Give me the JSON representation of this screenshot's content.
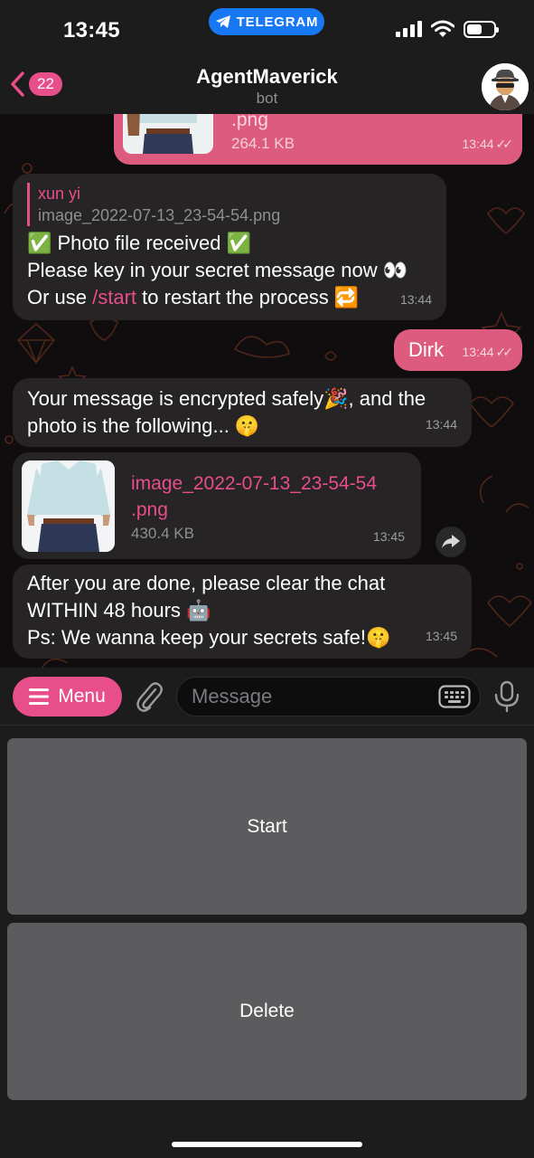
{
  "status_bar": {
    "time": "13:45",
    "app_pill": "TELEGRAM"
  },
  "header": {
    "back_count": "22",
    "title": "AgentMaverick",
    "subtitle": "bot"
  },
  "messages": {
    "m0": {
      "file_ext": ".png",
      "size": "264.1 KB",
      "time": "13:44"
    },
    "m1": {
      "reply_name": "xun yi",
      "reply_text": "image_2022-07-13_23-54-54.png",
      "line1": "✅ Photo file received ✅",
      "line2": "Please key in your secret message now 👀",
      "line3_pre": "Or use ",
      "line3_link": "/start",
      "line3_post": " to restart the process 🔁",
      "time": "13:44"
    },
    "m2": {
      "text": "Dirk",
      "time": "13:44"
    },
    "m3": {
      "line1": "Your message is encrypted safely🎉, and the",
      "line2": "photo is the following... 🤫",
      "time": "13:44"
    },
    "m4": {
      "file_name_1": "image_2022-07-13_23-54-54",
      "file_name_2": ".png",
      "size": "430.4 KB",
      "time": "13:45"
    },
    "m5": {
      "line1": "After you are done, please clear the chat",
      "line2": "WITHIN 48 hours 🤖",
      "line3": "Ps: We wanna keep your secrets safe!🤫",
      "time": "13:45"
    }
  },
  "input": {
    "menu_label": "Menu",
    "placeholder": "Message"
  },
  "keyboard": {
    "start": "Start",
    "delete": "Delete"
  },
  "colors": {
    "accent": "#e84e8a",
    "outgoing_bubble": "#dc5b7f",
    "incoming_bubble": "#262425"
  }
}
